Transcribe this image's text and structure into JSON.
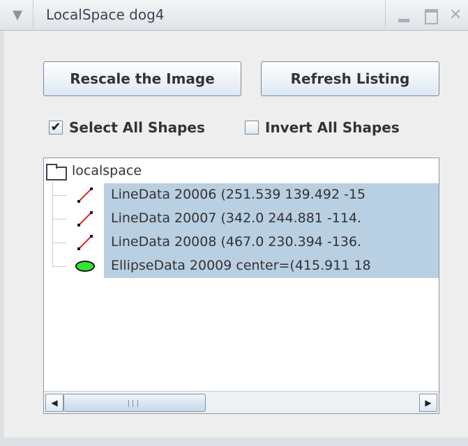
{
  "window": {
    "title": "LocalSpace dog4"
  },
  "toolbar": {
    "rescale_label": "Rescale the Image",
    "refresh_label": "Refresh Listing"
  },
  "options": {
    "select_all": {
      "label": "Select All Shapes",
      "checked": true,
      "mark": "✔"
    },
    "invert_all": {
      "label": "Invert All Shapes",
      "checked": false,
      "mark": ""
    }
  },
  "tree": {
    "root_label": "localspace",
    "root_icon": "folder-icon",
    "items": [
      {
        "label": "LineData 20006 (251.539 139.492 -15",
        "icon": "line-data-icon",
        "selected": true
      },
      {
        "label": "LineData 20007 (342.0 244.881 -114.",
        "icon": "line-data-icon",
        "selected": true
      },
      {
        "label": "LineData 20008 (467.0 230.394 -136.",
        "icon": "line-data-icon",
        "selected": true
      },
      {
        "label": "EllipseData 20009 center=(415.911 18",
        "icon": "ellipse-data-icon",
        "selected": true
      }
    ]
  },
  "colors": {
    "selection": "#b9cfe2",
    "line_icon": "#e0201c",
    "ellipse_icon": "#2ee82e"
  }
}
